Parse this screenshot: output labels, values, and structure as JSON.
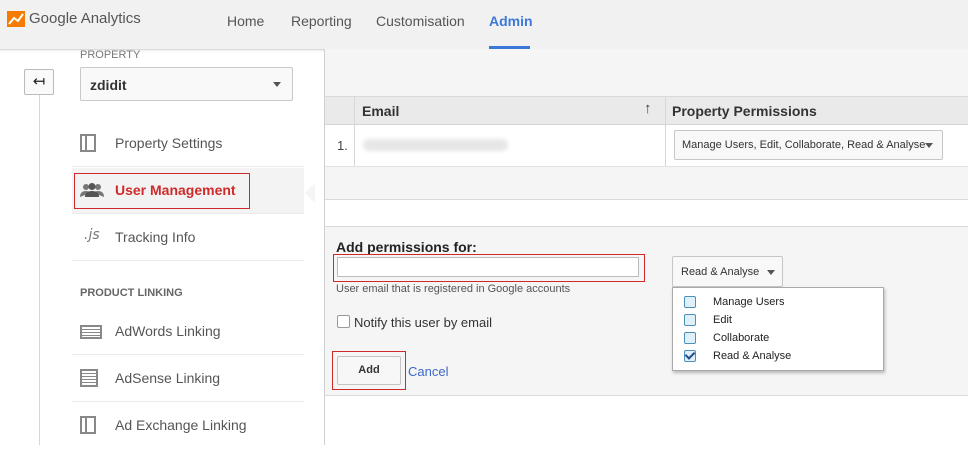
{
  "header": {
    "logo_text": "Google Analytics",
    "nav": [
      "Home",
      "Reporting",
      "Customisation",
      "Admin"
    ],
    "active_nav": "Admin",
    "accent": "#3c78d8",
    "logo_color": "#f57c00"
  },
  "sidebar": {
    "back_glyph": "↤",
    "property_label": "PROPERTY",
    "property_value": "zdidit",
    "items": [
      {
        "label": "Property Settings",
        "icon": "page-icon"
      },
      {
        "label": "User Management",
        "icon": "users-icon"
      },
      {
        "label": "Tracking Info",
        "icon": "js-icon"
      }
    ],
    "product_linking_label": "PRODUCT LINKING",
    "linking_items": [
      {
        "label": "AdWords Linking",
        "icon": "adwords-icon"
      },
      {
        "label": "AdSense Linking",
        "icon": "adsense-icon"
      },
      {
        "label": "Ad Exchange Linking",
        "icon": "adexchange-icon"
      }
    ]
  },
  "users_table": {
    "columns": [
      "Email",
      "Property Permissions"
    ],
    "sort_glyph": "↑",
    "rows": [
      {
        "index": "1.",
        "permissions": "Manage Users, Edit, Collaborate, Read & Analyse"
      }
    ]
  },
  "add_permissions": {
    "title": "Add permissions for:",
    "email_value": "",
    "help_text": "User email that is registered in Google accounts",
    "notify_label": "Notify this user by email",
    "notify_checked": false,
    "add_label": "Add",
    "cancel_label": "Cancel",
    "permission_select_value": "Read & Analyse",
    "permission_options": [
      {
        "label": "Manage Users",
        "checked": false
      },
      {
        "label": "Edit",
        "checked": false
      },
      {
        "label": "Collaborate",
        "checked": false
      },
      {
        "label": "Read & Analyse",
        "checked": true
      }
    ]
  },
  "highlight_color": "#cf2a2a"
}
